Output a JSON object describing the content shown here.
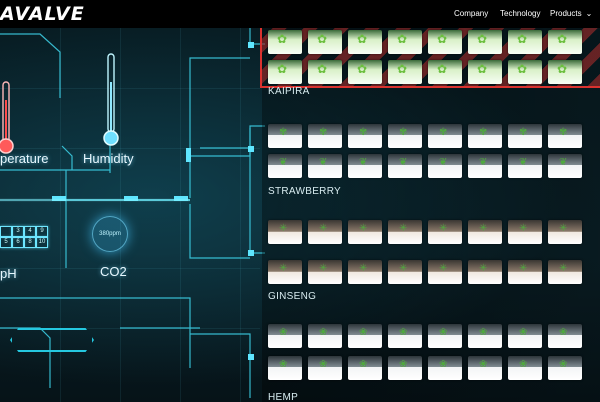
{
  "nav": {
    "logo": "AVALVE",
    "items": [
      {
        "label": "Company"
      },
      {
        "label": "Technology"
      },
      {
        "label": "Products",
        "has_dropdown": true
      }
    ]
  },
  "sensors": {
    "temperature_label": "perature",
    "humidity_label": "Humidity",
    "ph_label": "pH",
    "co2_label": "CO2",
    "co2_value": "380ppm",
    "ph_scale": [
      "3",
      "4",
      "5",
      "6",
      "8",
      "9",
      "10"
    ]
  },
  "crops": [
    {
      "name": "KAIPIRA",
      "style": "kaipira"
    },
    {
      "name": "STRAWBERRY",
      "style": "strawberry"
    },
    {
      "name": "GINSENG",
      "style": "ginseng"
    },
    {
      "name": "HEMP",
      "style": "hemp"
    }
  ],
  "colors": {
    "glow": "#5fe6ff",
    "alert": "#d9322f",
    "background": "#06141a"
  }
}
